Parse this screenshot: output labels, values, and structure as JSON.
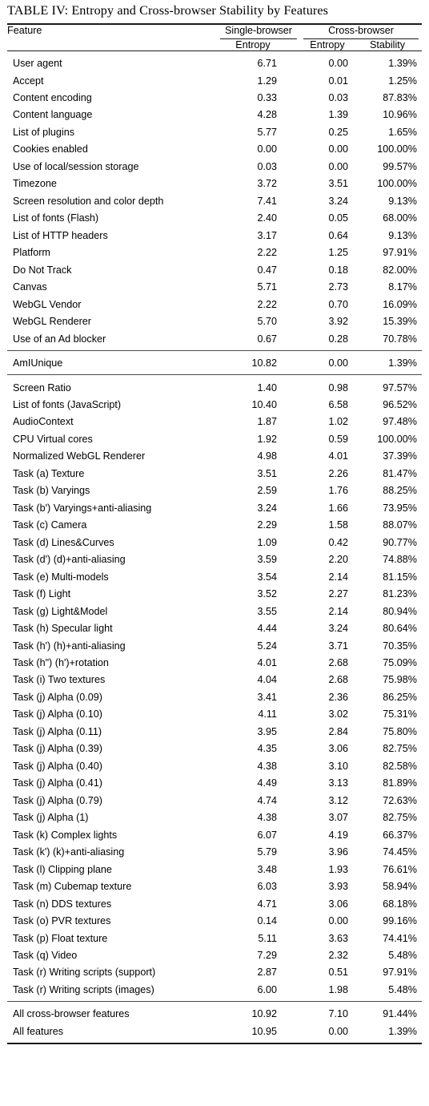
{
  "caption": "TABLE IV: Entropy and Cross-browser Stability by Features",
  "header": {
    "feature": "Feature",
    "group_single": "Single-browser",
    "group_cross": "Cross-browser",
    "sub_single_entropy": "Entropy",
    "sub_cross_entropy": "Entropy",
    "sub_cross_stability": "Stability"
  },
  "chart_data": {
    "type": "table",
    "title": "TABLE IV: Entropy and Cross-browser Stability by Features",
    "columns": [
      "Feature",
      "Single-browser Entropy",
      "Cross-browser Entropy",
      "Cross-browser Stability"
    ],
    "column_groups": [
      {
        "label": "Single-browser",
        "span": 1
      },
      {
        "label": "Cross-browser",
        "span": 2
      }
    ],
    "sections": [
      {
        "id": "standard-features",
        "rows": [
          {
            "feature": "User agent",
            "single_entropy": "6.71",
            "cross_entropy": "0.00",
            "stability": "1.39%"
          },
          {
            "feature": "Accept",
            "single_entropy": "1.29",
            "cross_entropy": "0.01",
            "stability": "1.25%"
          },
          {
            "feature": "Content encoding",
            "single_entropy": "0.33",
            "cross_entropy": "0.03",
            "stability": "87.83%"
          },
          {
            "feature": "Content language",
            "single_entropy": "4.28",
            "cross_entropy": "1.39",
            "stability": "10.96%"
          },
          {
            "feature": "List of plugins",
            "single_entropy": "5.77",
            "cross_entropy": "0.25",
            "stability": "1.65%"
          },
          {
            "feature": "Cookies enabled",
            "single_entropy": "0.00",
            "cross_entropy": "0.00",
            "stability": "100.00%"
          },
          {
            "feature": "Use of local/session storage",
            "single_entropy": "0.03",
            "cross_entropy": "0.00",
            "stability": "99.57%"
          },
          {
            "feature": "Timezone",
            "single_entropy": "3.72",
            "cross_entropy": "3.51",
            "stability": "100.00%"
          },
          {
            "feature": "Screen resolution and color depth",
            "single_entropy": "7.41",
            "cross_entropy": "3.24",
            "stability": "9.13%"
          },
          {
            "feature": "List of fonts (Flash)",
            "single_entropy": "2.40",
            "cross_entropy": "0.05",
            "stability": "68.00%"
          },
          {
            "feature": "List of HTTP headers",
            "single_entropy": "3.17",
            "cross_entropy": "0.64",
            "stability": "9.13%"
          },
          {
            "feature": "Platform",
            "single_entropy": "2.22",
            "cross_entropy": "1.25",
            "stability": "97.91%"
          },
          {
            "feature": "Do Not Track",
            "single_entropy": "0.47",
            "cross_entropy": "0.18",
            "stability": "82.00%"
          },
          {
            "feature": "Canvas",
            "single_entropy": "5.71",
            "cross_entropy": "2.73",
            "stability": "8.17%"
          },
          {
            "feature": "WebGL Vendor",
            "single_entropy": "2.22",
            "cross_entropy": "0.70",
            "stability": "16.09%"
          },
          {
            "feature": "WebGL Renderer",
            "single_entropy": "5.70",
            "cross_entropy": "3.92",
            "stability": "15.39%"
          },
          {
            "feature": "Use of an Ad blocker",
            "single_entropy": "0.67",
            "cross_entropy": "0.28",
            "stability": "70.78%"
          }
        ]
      },
      {
        "id": "amiunique-summary",
        "rows": [
          {
            "feature": "AmIUnique",
            "single_entropy": "10.82",
            "cross_entropy": "0.00",
            "stability": "1.39%"
          }
        ]
      },
      {
        "id": "new-features",
        "rows": [
          {
            "feature": "Screen Ratio",
            "single_entropy": "1.40",
            "cross_entropy": "0.98",
            "stability": "97.57%"
          },
          {
            "feature": "List of fonts (JavaScript)",
            "single_entropy": "10.40",
            "cross_entropy": "6.58",
            "stability": "96.52%"
          },
          {
            "feature": "AudioContext",
            "single_entropy": "1.87",
            "cross_entropy": "1.02",
            "stability": "97.48%"
          },
          {
            "feature": "CPU Virtual cores",
            "single_entropy": "1.92",
            "cross_entropy": "0.59",
            "stability": "100.00%"
          },
          {
            "feature": "Normalized WebGL Renderer",
            "single_entropy": "4.98",
            "cross_entropy": "4.01",
            "stability": "37.39%"
          },
          {
            "feature": "Task (a) Texture",
            "single_entropy": "3.51",
            "cross_entropy": "2.26",
            "stability": "81.47%"
          },
          {
            "feature": "Task (b) Varyings",
            "single_entropy": "2.59",
            "cross_entropy": "1.76",
            "stability": "88.25%"
          },
          {
            "feature": "Task (b') Varyings+anti-aliasing",
            "single_entropy": "3.24",
            "cross_entropy": "1.66",
            "stability": "73.95%"
          },
          {
            "feature": "Task (c) Camera",
            "single_entropy": "2.29",
            "cross_entropy": "1.58",
            "stability": "88.07%"
          },
          {
            "feature": "Task (d) Lines&Curves",
            "single_entropy": "1.09",
            "cross_entropy": "0.42",
            "stability": "90.77%"
          },
          {
            "feature": "Task (d') (d)+anti-aliasing",
            "single_entropy": "3.59",
            "cross_entropy": "2.20",
            "stability": "74.88%"
          },
          {
            "feature": "Task (e) Multi-models",
            "single_entropy": "3.54",
            "cross_entropy": "2.14",
            "stability": "81.15%"
          },
          {
            "feature": "Task (f) Light",
            "single_entropy": "3.52",
            "cross_entropy": "2.27",
            "stability": "81.23%"
          },
          {
            "feature": "Task (g) Light&Model",
            "single_entropy": "3.55",
            "cross_entropy": "2.14",
            "stability": "80.94%"
          },
          {
            "feature": "Task (h) Specular light",
            "single_entropy": "4.44",
            "cross_entropy": "3.24",
            "stability": "80.64%"
          },
          {
            "feature": "Task (h') (h)+anti-aliasing",
            "single_entropy": "5.24",
            "cross_entropy": "3.71",
            "stability": "70.35%"
          },
          {
            "feature": "Task (h\") (h')+rotation",
            "single_entropy": "4.01",
            "cross_entropy": "2.68",
            "stability": "75.09%"
          },
          {
            "feature": "Task (i) Two textures",
            "single_entropy": "4.04",
            "cross_entropy": "2.68",
            "stability": "75.98%"
          },
          {
            "feature": "Task (j) Alpha (0.09)",
            "single_entropy": "3.41",
            "cross_entropy": "2.36",
            "stability": "86.25%"
          },
          {
            "feature": "Task (j) Alpha (0.10)",
            "single_entropy": "4.11",
            "cross_entropy": "3.02",
            "stability": "75.31%"
          },
          {
            "feature": "Task (j) Alpha (0.11)",
            "single_entropy": "3.95",
            "cross_entropy": "2.84",
            "stability": "75.80%"
          },
          {
            "feature": "Task (j) Alpha (0.39)",
            "single_entropy": "4.35",
            "cross_entropy": "3.06",
            "stability": "82.75%"
          },
          {
            "feature": "Task (j) Alpha (0.40)",
            "single_entropy": "4.38",
            "cross_entropy": "3.10",
            "stability": "82.58%"
          },
          {
            "feature": "Task (j) Alpha (0.41)",
            "single_entropy": "4.49",
            "cross_entropy": "3.13",
            "stability": "81.89%"
          },
          {
            "feature": "Task (j) Alpha (0.79)",
            "single_entropy": "4.74",
            "cross_entropy": "3.12",
            "stability": "72.63%"
          },
          {
            "feature": "Task (j) Alpha (1)",
            "single_entropy": "4.38",
            "cross_entropy": "3.07",
            "stability": "82.75%"
          },
          {
            "feature": "Task (k) Complex lights",
            "single_entropy": "6.07",
            "cross_entropy": "4.19",
            "stability": "66.37%"
          },
          {
            "feature": "Task (k') (k)+anti-aliasing",
            "single_entropy": "5.79",
            "cross_entropy": "3.96",
            "stability": "74.45%"
          },
          {
            "feature": "Task (l) Clipping plane",
            "single_entropy": "3.48",
            "cross_entropy": "1.93",
            "stability": "76.61%"
          },
          {
            "feature": "Task (m) Cubemap texture",
            "single_entropy": "6.03",
            "cross_entropy": "3.93",
            "stability": "58.94%"
          },
          {
            "feature": "Task (n) DDS textures",
            "single_entropy": "4.71",
            "cross_entropy": "3.06",
            "stability": "68.18%"
          },
          {
            "feature": "Task (o) PVR textures",
            "single_entropy": "0.14",
            "cross_entropy": "0.00",
            "stability": "99.16%"
          },
          {
            "feature": "Task (p) Float texture",
            "single_entropy": "5.11",
            "cross_entropy": "3.63",
            "stability": "74.41%"
          },
          {
            "feature": "Task (q) Video",
            "single_entropy": "7.29",
            "cross_entropy": "2.32",
            "stability": "5.48%"
          },
          {
            "feature": "Task (r) Writing scripts (support)",
            "single_entropy": "2.87",
            "cross_entropy": "0.51",
            "stability": "97.91%"
          },
          {
            "feature": "Task (r) Writing scripts (images)",
            "single_entropy": "6.00",
            "cross_entropy": "1.98",
            "stability": "5.48%"
          }
        ]
      },
      {
        "id": "totals",
        "rows": [
          {
            "feature": "All cross-browser features",
            "single_entropy": "10.92",
            "cross_entropy": "7.10",
            "stability": "91.44%"
          },
          {
            "feature": "All features",
            "single_entropy": "10.95",
            "cross_entropy": "0.00",
            "stability": "1.39%"
          }
        ]
      }
    ]
  }
}
